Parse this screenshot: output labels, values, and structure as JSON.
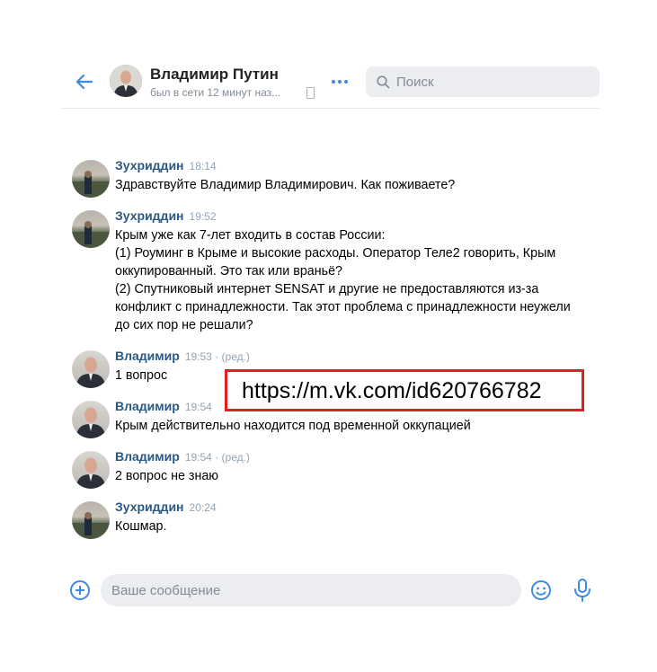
{
  "header": {
    "name": "Владимир Путин",
    "status": "был в сети 12 минут наз...",
    "search_placeholder": "Поиск"
  },
  "messages": [
    {
      "author": "Зухриддин",
      "time": "18:14",
      "edited": "",
      "lines": [
        "Здравствуйте Владимир Владимирович. Как поживаете?"
      ]
    },
    {
      "author": "Зухриддин",
      "time": "19:52",
      "edited": "",
      "lines": [
        "Крым уже как 7-лет входить в состав России:",
        "(1) Роуминг в Крыме и высокие расходы. Оператор Теле2 говорить, Крым",
        "оккупированный. Это так или враньё?",
        "(2) Спутниковый интернет SENSAT и другие не предоставляются из-за",
        "конфликт с принадлежности. Так этот проблема с принадлежности неужели",
        "до сих пор не решали?"
      ]
    },
    {
      "author": "Владимир",
      "time": "19:53",
      "edited": "· (ред.)",
      "lines": [
        "1 вопрос"
      ]
    },
    {
      "author": "Владимир",
      "time": "19:54",
      "edited": "",
      "lines": [
        "Крым действительно находится под временной оккупацией"
      ]
    },
    {
      "author": "Владимир",
      "time": "19:54",
      "edited": "· (ред.)",
      "lines": [
        "2 вопрос не знаю"
      ]
    },
    {
      "author": "Зухриддин",
      "time": "20:24",
      "edited": "",
      "lines": [
        "Кошмар."
      ]
    }
  ],
  "overlay_url": "https://m.vk.com/id620766782",
  "composer": {
    "placeholder": "Ваше сообщение"
  },
  "colors": {
    "accent": "#3f8ae0",
    "author": "#2a5885",
    "overlay_border": "#e01e24"
  }
}
